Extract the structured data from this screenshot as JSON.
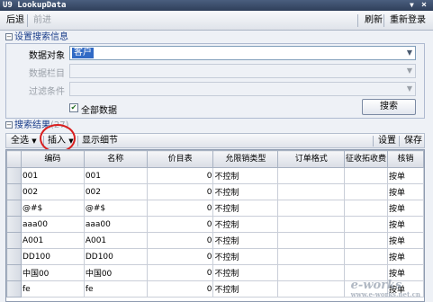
{
  "window": {
    "title": "U9 LookupData",
    "dropdown_glyph": "▼",
    "close_glyph": "×"
  },
  "toolbar": {
    "back_label": "后退",
    "forward_label": "前进",
    "refresh_label": "刷新",
    "relogin_label": "重新登录"
  },
  "search_settings": {
    "header": "设置搜索信息",
    "object_label": "数据对象",
    "object_value": "客户",
    "column_label": "数据栏目",
    "filter_label": "过滤条件",
    "all_data_label": "全部数据",
    "all_data_checked": true,
    "search_button": "搜索"
  },
  "results": {
    "header": "搜索结果",
    "header_suffix": "(27)",
    "select_all_label": "全选",
    "insert_label": "插入",
    "show_detail_label": "显示细节",
    "settings_label": "设置",
    "save_label": "保存"
  },
  "table": {
    "columns": [
      "编码",
      "名称",
      "价目表",
      "允限销类型",
      "订单格式",
      "征收拓收费",
      "核销"
    ],
    "rows": [
      [
        "001",
        "001",
        "0",
        "不控制",
        "",
        "",
        "按单"
      ],
      [
        "002",
        "002",
        "0",
        "不控制",
        "",
        "",
        "按单"
      ],
      [
        "@#$",
        "@#$",
        "0",
        "不控制",
        "",
        "",
        "按单"
      ],
      [
        "aaa00",
        "aaa00",
        "0",
        "不控制",
        "",
        "",
        "按单"
      ],
      [
        "A001",
        "A001",
        "0",
        "不控制",
        "",
        "",
        "按单"
      ],
      [
        "DD100",
        "DD100",
        "0",
        "不控制",
        "",
        "",
        "按单"
      ],
      [
        "中国00",
        "中国00",
        "0",
        "不控制",
        "",
        "",
        "按单"
      ],
      [
        "fe",
        "fe",
        "0",
        "不控制",
        "",
        "",
        "按单"
      ]
    ]
  },
  "watermark": {
    "main": "e-works",
    "sub": "www.e-works.net.cn"
  }
}
